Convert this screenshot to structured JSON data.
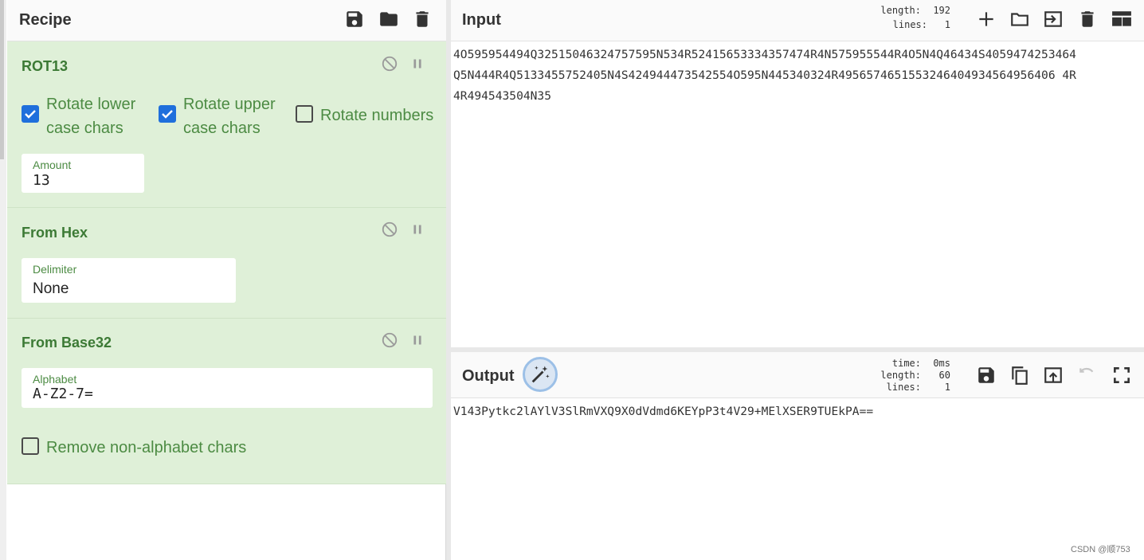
{
  "recipe": {
    "title": "Recipe",
    "header_icons": [
      "save-icon",
      "folder-icon",
      "trash-icon"
    ],
    "operations": [
      {
        "name": "ROT13",
        "checkboxes": [
          {
            "line1": "Rotate lower",
            "line2": "case chars",
            "checked": true
          },
          {
            "line1": "Rotate upper",
            "line2": "case chars",
            "checked": true
          },
          {
            "line1": "Rotate numbers",
            "checked": false
          }
        ],
        "field": {
          "label": "Amount",
          "value": "13"
        }
      },
      {
        "name": "From Hex",
        "field": {
          "label": "Delimiter",
          "value": "None"
        }
      },
      {
        "name": "From Base32",
        "field": {
          "label": "Alphabet",
          "value": "A-Z2-7="
        },
        "checkbox": {
          "label": "Remove non-alphabet chars",
          "checked": false
        }
      }
    ]
  },
  "input": {
    "title": "Input",
    "length_label": "length:",
    "length_value": "192",
    "lines_label": "lines:",
    "lines_value": "1",
    "line1": "4O595954494Q32515046324757595N534R52415653334357474R4N575955544R4O5N4Q46434S4059474253464",
    "line2": "Q5N444R4Q5133455752405N4S424944473542554O595N445340324R4956574651553246404934564956406 4R",
    "line3": "4R494543504N35",
    "header_icons": [
      "plus-icon",
      "folder-icon",
      "import-icon",
      "trash-icon",
      "layout-icon"
    ]
  },
  "output": {
    "title": "Output",
    "time_label": "time:",
    "time_value": "0ms",
    "length_label": "length:",
    "length_value": "60",
    "lines_label": "lines:",
    "lines_value": "1",
    "text": "V143Pytkc2lAYlV3SlRmVXQ9X0dVdmd6KEYpP3t4V29+MElXSER9TUEkPA==",
    "header_icons": [
      "save-icon",
      "copy-icon",
      "replace-input-icon",
      "undo-icon",
      "fullscreen-icon"
    ]
  },
  "watermark": "CSDN @顺753"
}
